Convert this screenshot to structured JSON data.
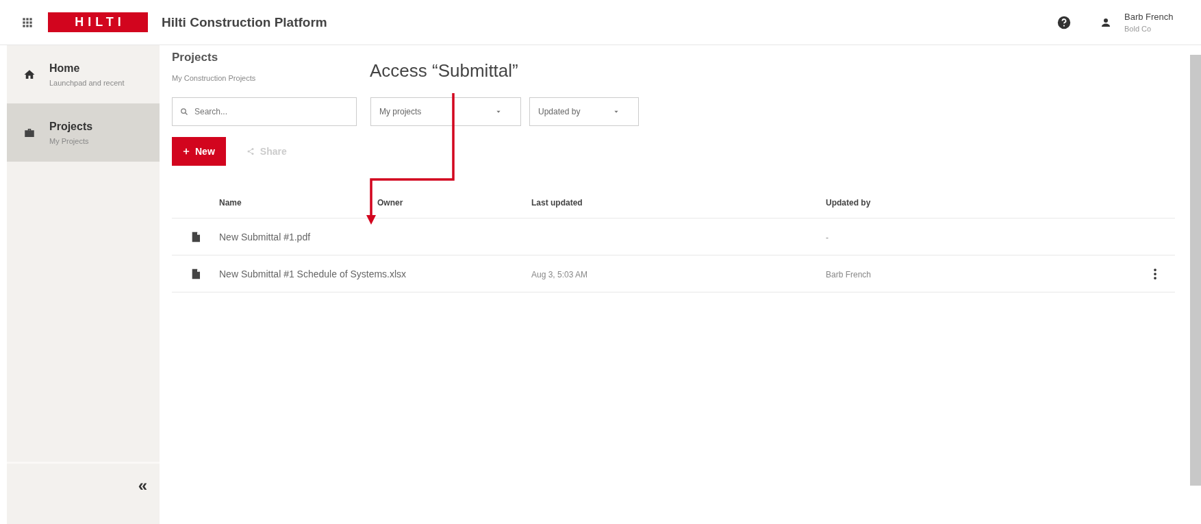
{
  "header": {
    "logo": "HILTI",
    "title": "Hilti Construction Platform",
    "user": {
      "name": "Barb French",
      "company": "Bold Co"
    }
  },
  "sidebar": {
    "items": [
      {
        "title": "Home",
        "subtitle": "Launchpad and recent",
        "selected": false
      },
      {
        "title": "Projects",
        "subtitle": "My Projects",
        "selected": true
      }
    ],
    "collapse": "«"
  },
  "page": {
    "title": "Projects",
    "subtitle": "My Construction Projects"
  },
  "toolbar": {
    "search": {
      "placeholder": "Search..."
    },
    "filters": [
      {
        "value": "My projects"
      },
      {
        "value": "Updated by"
      }
    ],
    "buttons": [
      {
        "label": "New",
        "kind": "primary",
        "disabled": false
      },
      {
        "label": "Share",
        "kind": "share",
        "disabled": true
      }
    ]
  },
  "table": {
    "columns": [
      "Name",
      "Owner",
      "Last updated",
      "Updated by"
    ],
    "rows": [
      {
        "name": "New Submittal #1.pdf",
        "updated_by": "-",
        "menu": false
      },
      {
        "name": "New Submittal #1 Schedule of Systems.xlsx",
        "last_updated": "Aug 3, 5:03 AM",
        "updated_by": "Barb French",
        "menu": true
      }
    ]
  },
  "annotation": {
    "text": "Access “Submittal”"
  }
}
